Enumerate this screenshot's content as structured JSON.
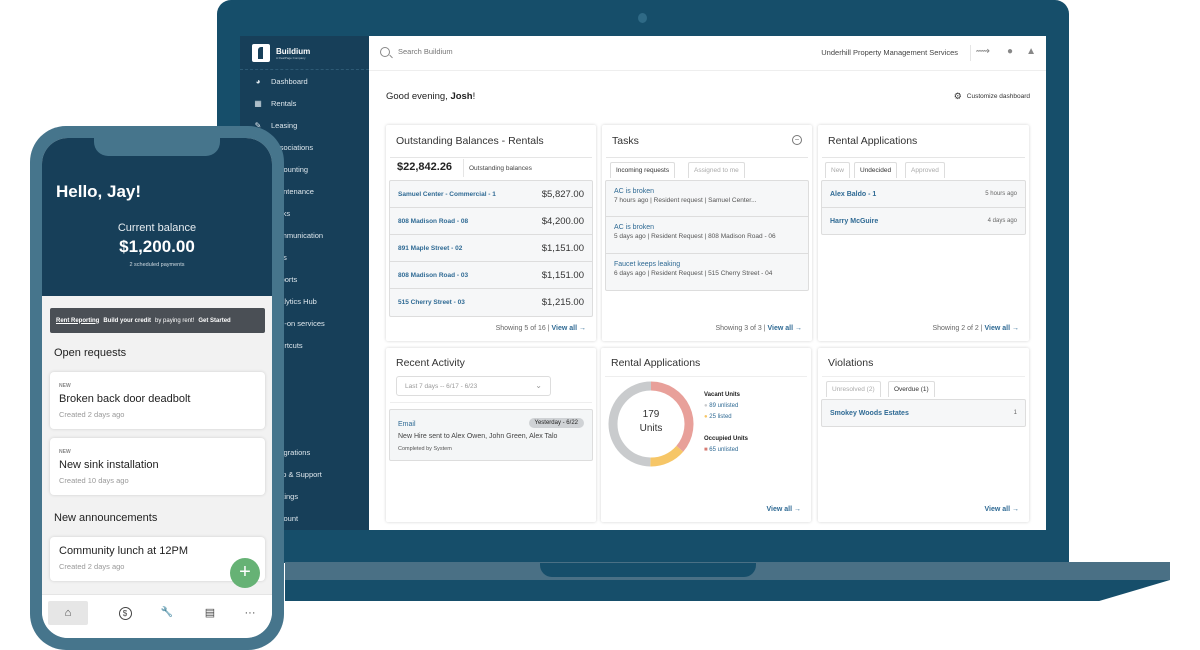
{
  "desktop": {
    "brand": {
      "name": "Buildium",
      "subtitle": "A RealPage Company"
    },
    "sidebar": {
      "items": [
        {
          "label": "Dashboard",
          "icon": "dashboard-icon"
        },
        {
          "label": "Rentals",
          "icon": "building-icon"
        },
        {
          "label": "Leasing",
          "icon": "leasing-icon"
        },
        {
          "label": "Associations",
          "icon": "associations-icon"
        },
        {
          "label": "Accounting",
          "icon": "accounting-icon"
        },
        {
          "label": "Maintenance",
          "icon": "maintenance-icon"
        },
        {
          "label": "Tasks",
          "icon": "tasks-icon"
        },
        {
          "label": "Communication",
          "icon": "communication-icon"
        },
        {
          "label": "Files",
          "icon": "files-icon"
        },
        {
          "label": "Reports",
          "icon": "reports-icon"
        },
        {
          "label": "Analytics Hub",
          "icon": "analytics-icon"
        },
        {
          "label": "Add-on services",
          "icon": "addon-icon"
        },
        {
          "label": "Shortcuts",
          "icon": "shortcuts-icon"
        }
      ],
      "bottom_items": [
        {
          "label": "Integrations",
          "icon": "integrations-icon"
        },
        {
          "label": "Help & Support",
          "icon": "help-icon"
        },
        {
          "label": "Settings",
          "icon": "settings-icon"
        },
        {
          "label": "Account",
          "icon": "account-icon"
        }
      ]
    },
    "topbar": {
      "search_placeholder": "Search Buildium",
      "company": "Underhill Property Management Services",
      "icons": [
        "activity-icon",
        "chat-icon",
        "bell-icon"
      ]
    },
    "greeting": {
      "prefix": "Good evening, ",
      "name": "Josh",
      "suffix": "!"
    },
    "customize_label": "Customize dashboard",
    "outstanding": {
      "title": "Outstanding Balances - Rentals",
      "total": "$22,842.26",
      "total_label": "Outstanding balances",
      "rows": [
        {
          "name": "Samuel Center - Commercial - 1",
          "amount": "$5,827.00"
        },
        {
          "name": "808 Madison Road - 08",
          "amount": "$4,200.00"
        },
        {
          "name": "891 Maple Street - 02",
          "amount": "$1,151.00"
        },
        {
          "name": "808 Madison Road - 03",
          "amount": "$1,151.00"
        },
        {
          "name": "515 Cherry Street - 03",
          "amount": "$1,215.00"
        }
      ],
      "showing": "Showing 5 of 16 |",
      "view_all": "View all →"
    },
    "tasks": {
      "title": "Tasks",
      "tabs": [
        "Incoming requests",
        "Assigned to me"
      ],
      "active_tab": "Incoming requests",
      "rows": [
        {
          "title": "AC is broken",
          "meta": "7 hours ago | Resident request | Samuel Center..."
        },
        {
          "title": "AC is broken",
          "meta": "5 days ago | Resident Request | 808 Madison Road - 06"
        },
        {
          "title": "Faucet keeps leaking",
          "meta": "6 days ago | Resident Request | 515 Cherry Street - 04"
        }
      ],
      "showing": "Showing 3 of 3 |",
      "view_all": "View all →"
    },
    "rental_apps": {
      "title": "Rental Applications",
      "tabs": [
        "New",
        "Undecided",
        "Approved"
      ],
      "active_tab": "Undecided",
      "rows": [
        {
          "name": "Alex Baldo - 1",
          "time": "5 hours ago"
        },
        {
          "name": "Harry McGuire",
          "time": "4 days ago"
        }
      ],
      "showing": "Showing 2 of 2 |",
      "view_all": "View all →"
    },
    "recent_activity": {
      "title": "Recent Activity",
      "range": "Last 7 days -- 6/17 - 6/23",
      "item": {
        "type": "Email",
        "date": "Yesterday - 6/22",
        "text": "New Hire sent to Alex Owen, John Green, Alex Talo",
        "by": "Completed by System"
      }
    },
    "units": {
      "title": "Rental Applications",
      "total": "179",
      "total_label": "Units",
      "vacant_label": "Vacant Units",
      "occupied_label": "Occupied Units",
      "segments": [
        {
          "label": "89 unlisted",
          "group": "vacant",
          "value": 89,
          "color": "#c9cbcd"
        },
        {
          "label": "25  listed",
          "group": "vacant",
          "value": 25,
          "color": "#f6c667"
        },
        {
          "label": "65 unlisted",
          "group": "occupied",
          "value": 65,
          "color": "#e8a09a"
        }
      ],
      "view_all": "View all →"
    },
    "violations": {
      "title": "Violations",
      "tabs": [
        "Unresolved (2)",
        "Overdue (1)"
      ],
      "active_tab": "Overdue (1)",
      "rows": [
        {
          "name": "Smokey Woods Estates",
          "count": "1"
        }
      ],
      "view_all": "View all →"
    }
  },
  "mobile": {
    "hello": "Hello, Jay!",
    "balance_label": "Current balance",
    "balance": "$1,200.00",
    "balance_sub": "2 scheduled payments",
    "banner": {
      "tag": "Rent Reporting",
      "bold": "Build your credit",
      "text": "by paying rent!",
      "cta": "Get Started"
    },
    "open_requests_title": "Open requests",
    "requests": [
      {
        "badge": "NEW",
        "title": "Broken back door deadbolt",
        "sub": "Created 2 days ago"
      },
      {
        "badge": "NEW",
        "title": "New sink installation",
        "sub": "Created 10 days ago"
      }
    ],
    "announcements_title": "New announcements",
    "announcements": [
      {
        "title": "Community lunch at 12PM",
        "sub": "Created 2 days ago"
      }
    ],
    "fab": "+",
    "nav": [
      {
        "name": "home",
        "glyph": "⌂"
      },
      {
        "name": "payments",
        "glyph": "$"
      },
      {
        "name": "maintenance",
        "glyph": "🔧"
      },
      {
        "name": "store",
        "glyph": "▤"
      },
      {
        "name": "more",
        "glyph": "···"
      }
    ]
  }
}
